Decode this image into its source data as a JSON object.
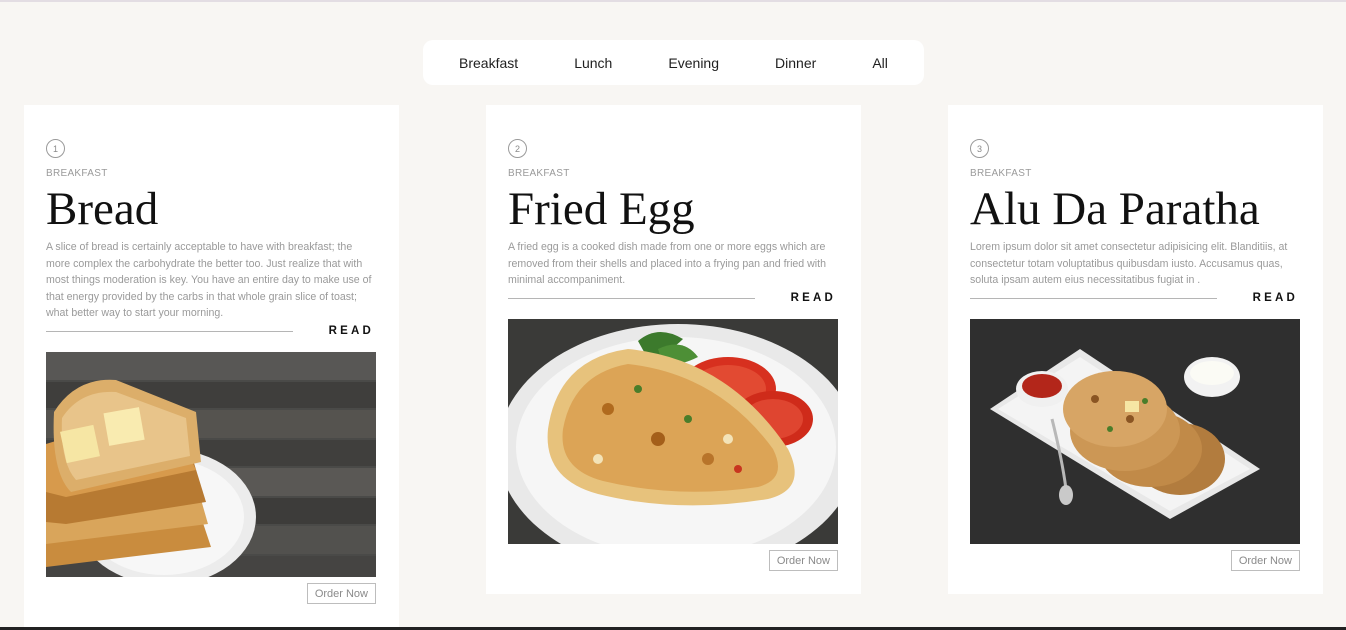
{
  "tabs": [
    "Breakfast",
    "Lunch",
    "Evening",
    "Dinner",
    "All"
  ],
  "read_label": "READ",
  "order_label": "Order Now",
  "cards": [
    {
      "number": "1",
      "category": "BREAKFAST",
      "title": "Bread",
      "description": "A slice of bread is certainly acceptable to have with breakfast; the more complex the carbohydrate the better too. Just realize that with most things moderation is key. You have an entire day to make use of that energy provided by the carbs in that whole grain slice of toast; what better way to start your morning.",
      "image": "bread-photo"
    },
    {
      "number": "2",
      "category": "BREAKFAST",
      "title": "Fried Egg",
      "description": "A fried egg is a cooked dish made from one or more eggs which are removed from their shells and placed into a frying pan and fried with minimal accompaniment.",
      "image": "omelette-photo"
    },
    {
      "number": "3",
      "category": "BREAKFAST",
      "title": "Alu Da Paratha",
      "description": "Lorem ipsum dolor sit amet consectetur adipisicing elit. Blanditiis, at consectetur totam voluptatibus quibusdam iusto. Accusamus quas, soluta ipsam autem eius necessitatibus fugiat in .",
      "image": "paratha-photo"
    }
  ]
}
